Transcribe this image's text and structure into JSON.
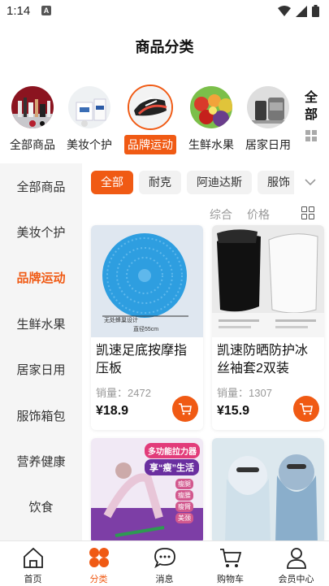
{
  "status": {
    "time": "1:14",
    "badge": "A"
  },
  "page_title": "商品分类",
  "top_categories": [
    {
      "label": "全部商品"
    },
    {
      "label": "美妆个护"
    },
    {
      "label": "品牌运动",
      "active": true
    },
    {
      "label": "生鲜水果"
    },
    {
      "label": "居家日用"
    }
  ],
  "all_button_label": "全部",
  "sidebar": [
    {
      "label": "全部商品"
    },
    {
      "label": "美妆个护"
    },
    {
      "label": "品牌运动",
      "active": true
    },
    {
      "label": "生鲜水果"
    },
    {
      "label": "居家日用"
    },
    {
      "label": "服饰箱包"
    },
    {
      "label": "营养健康"
    },
    {
      "label": "饮食"
    }
  ],
  "chips": [
    {
      "label": "全部",
      "active": true
    },
    {
      "label": "耐克"
    },
    {
      "label": "阿迪达斯"
    },
    {
      "label": "服饰"
    }
  ],
  "sort": {
    "comprehensive": "综合",
    "price": "价格"
  },
  "products": [
    {
      "title": "凯速足底按摩指压板",
      "sales_label": "销量：",
      "sales": "2472",
      "price": "¥18.9",
      "image_caption": "直径55cm",
      "image_caption2": "无处蜂巢设计"
    },
    {
      "title": "凯速防晒防护冰丝袖套2双装",
      "sales_label": "销量：",
      "sales": "1307",
      "price": "¥15.9"
    },
    {
      "title": "",
      "promo1": "多功能拉力器",
      "promo2": "享“瘦”生活",
      "tags": [
        "瘦腿",
        "瘦腰",
        "瘦臂",
        "美颈"
      ]
    },
    {
      "title": ""
    }
  ],
  "bottom_nav": [
    {
      "label": "首页",
      "icon": "home-icon"
    },
    {
      "label": "分类",
      "icon": "category-icon",
      "active": true
    },
    {
      "label": "消息",
      "icon": "message-icon"
    },
    {
      "label": "购物车",
      "icon": "cart-icon"
    },
    {
      "label": "会员中心",
      "icon": "user-icon"
    }
  ],
  "colors": {
    "accent": "#f05a14"
  }
}
